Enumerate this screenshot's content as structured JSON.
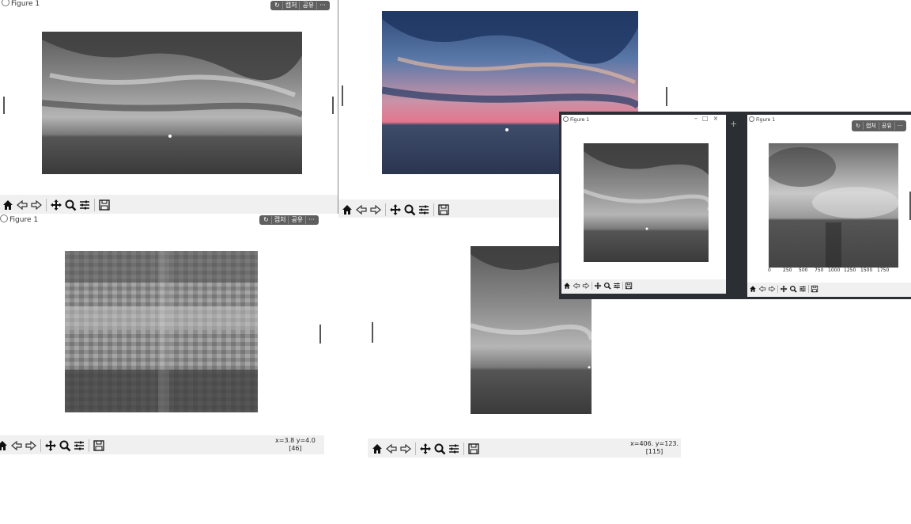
{
  "windows": {
    "w1": {
      "title": "Figure 1",
      "pill": [
        "↻",
        "캡처",
        "공유",
        "···"
      ]
    },
    "w2": {},
    "w3": {
      "title": "Figure 1",
      "pill": [
        "↻",
        "캡처",
        "공유",
        "···"
      ],
      "coord_line1": "x=3.8 y=4.0",
      "coord_line2": "[46]"
    },
    "w4": {
      "coord_line1": "x=406. y=123.",
      "coord_line2": "[115]"
    },
    "w5": {
      "title": "Figure 1"
    },
    "w6": {
      "title": "Figure 1",
      "pill": [
        "↻",
        "캡처",
        "공유",
        "···"
      ],
      "xticks": [
        "0",
        "250",
        "500",
        "750",
        "1000",
        "1250",
        "1500",
        "1750"
      ]
    }
  },
  "toolbar_icons": [
    "home-icon",
    "back-arrow-icon",
    "forward-arrow-icon",
    "pan-icon",
    "zoom-icon",
    "configure-subplots-icon",
    "save-icon"
  ],
  "colors": {
    "toolbar_bg": "#f0f0f0",
    "dark_panel": "#2b2f33",
    "pill_bg": "#5f5f5f"
  }
}
